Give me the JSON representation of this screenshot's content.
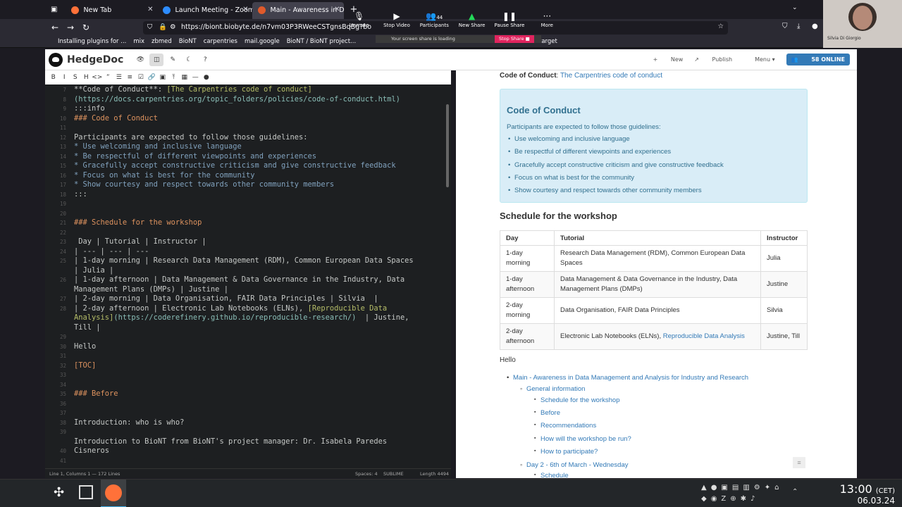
{
  "browser": {
    "tabs": [
      {
        "label": "New Tab",
        "fav_color": "#ff7139"
      },
      {
        "label": "Launch Meeting - Zoom",
        "fav_color": "#2d8cff"
      },
      {
        "label": "Main - Awareness in Dat",
        "fav_color": "#e05a2b"
      }
    ],
    "url": "https://biont.biobyte.de/n7vm03P3RWeeCSTgnsBqBg?bo",
    "bookmarks": [
      "Installing plugins for ...",
      "mix",
      "zbmed",
      "BioNT",
      "carpentries",
      "mail.google",
      "BioNT / BioNT project...",
      "target"
    ]
  },
  "zoom": {
    "buttons": [
      {
        "label": "Unmute",
        "icon": "mic-off-icon"
      },
      {
        "label": "Stop Video",
        "icon": "video-icon"
      },
      {
        "label": "Participants",
        "icon": "participants-icon",
        "count": "44"
      },
      {
        "label": "New Share",
        "icon": "share-icon"
      },
      {
        "label": "Pause Share",
        "icon": "pause-icon"
      },
      {
        "label": "More",
        "icon": "more-icon"
      }
    ],
    "share_status": "Your screen share is loading",
    "stop_share": "Stop Share",
    "presenter": "Silvia Di Giorgio"
  },
  "hedgedoc": {
    "brand": "HedgeDoc",
    "new": "New",
    "publish": "Publish",
    "menu": "Menu",
    "online": "58 ONLINE"
  },
  "toolbar": [
    "B",
    "I",
    "S",
    "H",
    "<>",
    "”",
    "☰",
    "≡",
    "☑",
    "🔗",
    "▣",
    "⤒",
    "▦",
    "—",
    "●"
  ],
  "editor": {
    "line_numbers": [
      "7",
      "8",
      "9",
      "10",
      "11",
      "12",
      "13",
      "14",
      "15",
      "16",
      "17",
      "18",
      "19",
      "20",
      "21",
      "22",
      "23",
      "24",
      "25",
      "",
      "26",
      "",
      "27",
      "28",
      "",
      "",
      "29",
      "30",
      "31",
      "32",
      "33",
      "34",
      "35",
      "36",
      "37",
      "38",
      "39",
      "",
      "40",
      "41"
    ],
    "status": {
      "pos": "Line 1, Columns 1 — 172 Lines",
      "spaces": "Spaces: 4",
      "keymap": "SUBLIME",
      "length": "Length 4494"
    }
  },
  "preview": {
    "coc_label": "Code of Conduct",
    "coc_link": "The Carpentries code of conduct",
    "alert_title": "Code of Conduct",
    "alert_intro": "Participants are expected to follow those guidelines:",
    "guidelines": [
      "Use welcoming and inclusive language",
      "Be respectful of different viewpoints and experiences",
      "Gracefully accept constructive criticism and give constructive feedback",
      "Focus on what is best for the community",
      "Show courtesy and respect towards other community members"
    ],
    "schedule_title": "Schedule for the workshop",
    "table": {
      "headers": [
        "Day",
        "Tutorial",
        "Instructor"
      ],
      "rows": [
        {
          "day": "1-day morning",
          "tutorial": "Research Data Management (RDM), Common European Data Spaces",
          "link": "",
          "instructor": "Julia"
        },
        {
          "day": "1-day afternoon",
          "tutorial": "Data Management & Data Governance in the Industry, Data Management Plans (DMPs)",
          "link": "",
          "instructor": "Justine"
        },
        {
          "day": "2-day morning",
          "tutorial": "Data Organisation, FAIR Data Principles",
          "link": "",
          "instructor": "Silvia"
        },
        {
          "day": "2-day afternoon",
          "tutorial": "Electronic Lab Notebooks (ELNs), ",
          "link": "Reproducible Data Analysis",
          "instructor": "Justine, Till"
        }
      ]
    },
    "hello": "Hello",
    "toc": [
      {
        "level": 1,
        "text": "Main - Awareness in Data Management and Analysis for Industry and Research"
      },
      {
        "level": 2,
        "text": "General information"
      },
      {
        "level": 3,
        "text": "Schedule for the workshop"
      },
      {
        "level": 3,
        "text": "Before"
      },
      {
        "level": 3,
        "text": "Recommendations"
      },
      {
        "level": 3,
        "text": "How will the workshop be run?"
      },
      {
        "level": 3,
        "text": "How to participate?"
      },
      {
        "level": 2,
        "text": "Day 2 - 6th of March - Wednesday"
      },
      {
        "level": 3,
        "text": "Schedule"
      }
    ]
  },
  "taskbar": {
    "time": "13:00",
    "tz": "(CET)",
    "date": "06.03.24"
  }
}
